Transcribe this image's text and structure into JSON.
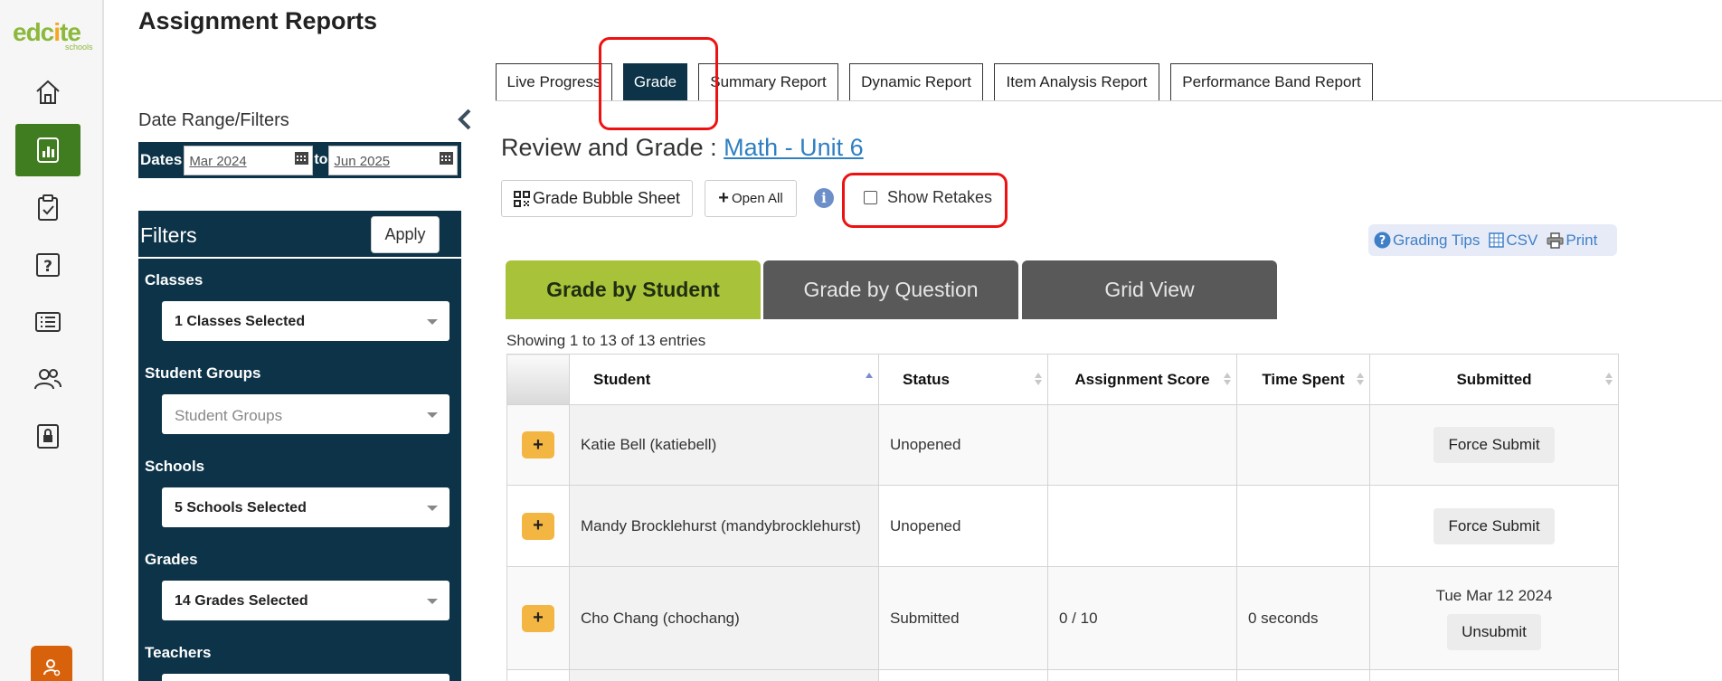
{
  "logo": {
    "brand_prefix": "edc",
    "brand_o": "i",
    "brand_suffix": "te",
    "sub": "schools"
  },
  "page_title": "Assignment Reports",
  "filter_panel": {
    "date_range_label": "Date Range/Filters",
    "dates_label": "Dates",
    "to_label": "to",
    "date_from": "Mar 2024",
    "date_to": "Jun 2025",
    "filters_title": "Filters",
    "apply_label": "Apply",
    "groups": [
      {
        "label": "Classes",
        "value": "1 Classes Selected",
        "placeholder": false
      },
      {
        "label": "Student Groups",
        "value": "Student Groups",
        "placeholder": true
      },
      {
        "label": "Schools",
        "value": "5 Schools Selected",
        "placeholder": false
      },
      {
        "label": "Grades",
        "value": "14 Grades Selected",
        "placeholder": false
      },
      {
        "label": "Teachers",
        "value": "",
        "placeholder": false
      }
    ]
  },
  "report_tabs": [
    "Live Progress",
    "Grade",
    "Summary Report",
    "Dynamic Report",
    "Item Analysis Report",
    "Performance Band Report"
  ],
  "active_report_tab": "Grade",
  "review": {
    "prefix": "Review and Grade : ",
    "assignment_link": "Math - Unit 6"
  },
  "actions": {
    "bubble_sheet": "Grade Bubble Sheet",
    "open_all": "Open All",
    "show_retakes": "Show Retakes",
    "show_retakes_checked": false
  },
  "tools": {
    "grading_tips": "Grading Tips",
    "csv": "CSV",
    "print": "Print"
  },
  "grade_tabs": [
    "Grade by Student",
    "Grade by Question",
    "Grid View"
  ],
  "active_grade_tab": "Grade by Student",
  "entries_text": "Showing 1 to 13 of 13 entries",
  "table": {
    "headers": [
      "",
      "Student",
      "Status",
      "Assignment Score",
      "Time Spent",
      "Submitted"
    ],
    "rows": [
      {
        "student": "Katie Bell (katiebell)",
        "status": "Unopened",
        "score": "",
        "time": "",
        "submitted_date": "",
        "action": "Force Submit"
      },
      {
        "student": "Mandy Brocklehurst (mandybrocklehurst)",
        "status": "Unopened",
        "score": "",
        "time": "",
        "submitted_date": "",
        "action": "Force Submit"
      },
      {
        "student": "Cho Chang (chochang)",
        "status": "Submitted",
        "score": "0 / 10",
        "time": "0 seconds",
        "submitted_date": "Tue Mar 12 2024",
        "action": "Unsubmit"
      }
    ]
  },
  "colors": {
    "nav_active": "#3f7d20",
    "panel_bg": "#0c3348",
    "tab_active_green": "#a8c23a",
    "tab_inactive": "#595959",
    "link_blue": "#2f7fc1",
    "plus_orange": "#f4b642",
    "highlight_red": "#ee1111",
    "bottom_btn": "#d8620b"
  },
  "nav_icons": [
    "home-icon",
    "reports-icon",
    "clipboard-check-icon",
    "question-icon",
    "list-icon",
    "users-icon",
    "lock-icon",
    "user-settings-icon"
  ]
}
